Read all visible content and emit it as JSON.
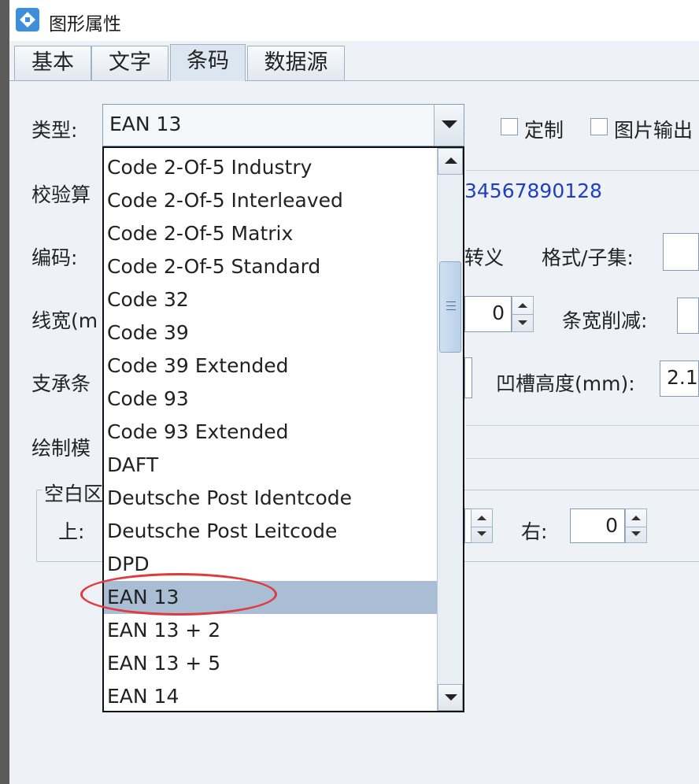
{
  "window": {
    "title": "图形属性"
  },
  "tabs": [
    "基本",
    "文字",
    "条码",
    "数据源"
  ],
  "form": {
    "type_label": "类型:",
    "type_value": "EAN 13",
    "custom_label": "定制",
    "image_output_label": "图片输出",
    "checksum_label": "校验算",
    "checksum_value": "34567890128",
    "encoding_label": "编码:",
    "escape_label": "转义",
    "format_subset_label": "格式/子集:",
    "line_width_label": "线宽(m",
    "line_width_value": "0",
    "bar_width_reduction_label": "条宽削减:",
    "support_bar_label": "支承条",
    "notch_height_label": "凹槽高度(mm):",
    "notch_height_value": "2.1",
    "draw_mode_label": "绘制模",
    "quiet_zone_label": "空白区",
    "top_label": "上:",
    "right_label": "右:",
    "right_value": "0"
  },
  "dropdown": {
    "items": [
      "Code 2-Of-5 Industry",
      "Code 2-Of-5 Interleaved",
      "Code 2-Of-5 Matrix",
      "Code 2-Of-5 Standard",
      "Code 32",
      "Code 39",
      "Code 39 Extended",
      "Code 93",
      "Code 93 Extended",
      "DAFT",
      "Deutsche Post Identcode",
      "Deutsche Post Leitcode",
      "DPD",
      "EAN 13",
      "EAN 13 + 2",
      "EAN 13 + 5",
      "EAN 14"
    ],
    "selected_index": 13
  },
  "colors": {
    "highlight_circle": "#e0393e",
    "selected_row": "#a9bdd4",
    "checksum_text": "#1f3fbf"
  }
}
